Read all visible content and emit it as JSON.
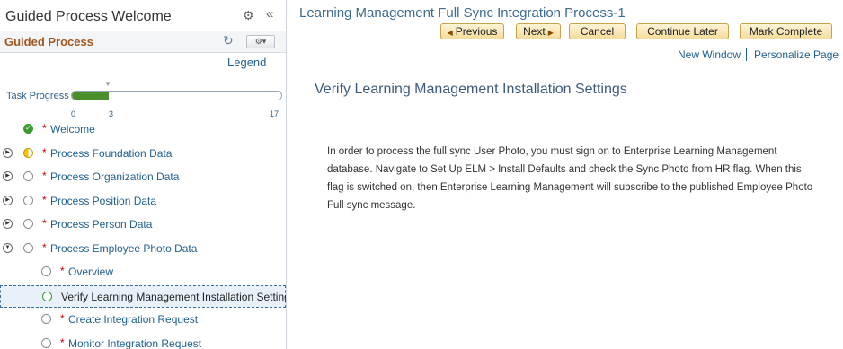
{
  "left_panel": {
    "title": "Guided Process Welcome",
    "guided_process_label": "Guided Process",
    "legend_link": "Legend",
    "task_progress": {
      "label": "Task Progress",
      "min": "0",
      "current": "3",
      "max": "17",
      "fraction": 0.176
    },
    "steps": [
      {
        "label": "Welcome",
        "required": true,
        "status": "complete",
        "expander": "none"
      },
      {
        "label": "Process Foundation Data",
        "required": true,
        "status": "in-progress",
        "expander": "collapsed"
      },
      {
        "label": "Process Organization Data",
        "required": true,
        "status": "not-started",
        "expander": "collapsed"
      },
      {
        "label": "Process Position Data",
        "required": true,
        "status": "not-started",
        "expander": "collapsed"
      },
      {
        "label": "Process Person Data",
        "required": true,
        "status": "not-started",
        "expander": "collapsed"
      },
      {
        "label": "Process Employee Photo Data",
        "required": true,
        "status": "not-started",
        "expander": "expanded"
      },
      {
        "label": "Overview",
        "required": true,
        "status": "not-started",
        "expander": "none"
      },
      {
        "label": "Verify Learning Management Installation Settings",
        "required": false,
        "status": "current",
        "expander": "none"
      },
      {
        "label": "Create Integration Request",
        "required": true,
        "status": "not-started",
        "expander": "none"
      },
      {
        "label": "Monitor Integration Request",
        "required": true,
        "status": "not-started",
        "expander": "none"
      }
    ]
  },
  "header": {
    "process_title": "Learning Management Full Sync Integration Process-1",
    "buttons": {
      "previous": "Previous",
      "next": "Next",
      "cancel": "Cancel",
      "continue_later": "Continue Later",
      "mark_complete": "Mark Complete"
    },
    "links": {
      "new_window": "New Window",
      "personalize_page": "Personalize Page"
    }
  },
  "content": {
    "heading": "Verify Learning Management Installation Settings",
    "body": "In order to process the full sync User Photo, you must sign on to Enterprise Learning Management database. Navigate to Set Up ELM > Install Defaults and check the Sync Photo from HR flag. When this flag is switched on, then Enterprise Learning Management will subscribe to the published Employee Photo Full sync message."
  },
  "colors": {
    "guided_process_label": "#a4561e",
    "link": "#1f5f8e",
    "progress_fill": "#4a8f2a",
    "button_fill": "#f4dc9c",
    "required_marker": "#cc0000"
  }
}
